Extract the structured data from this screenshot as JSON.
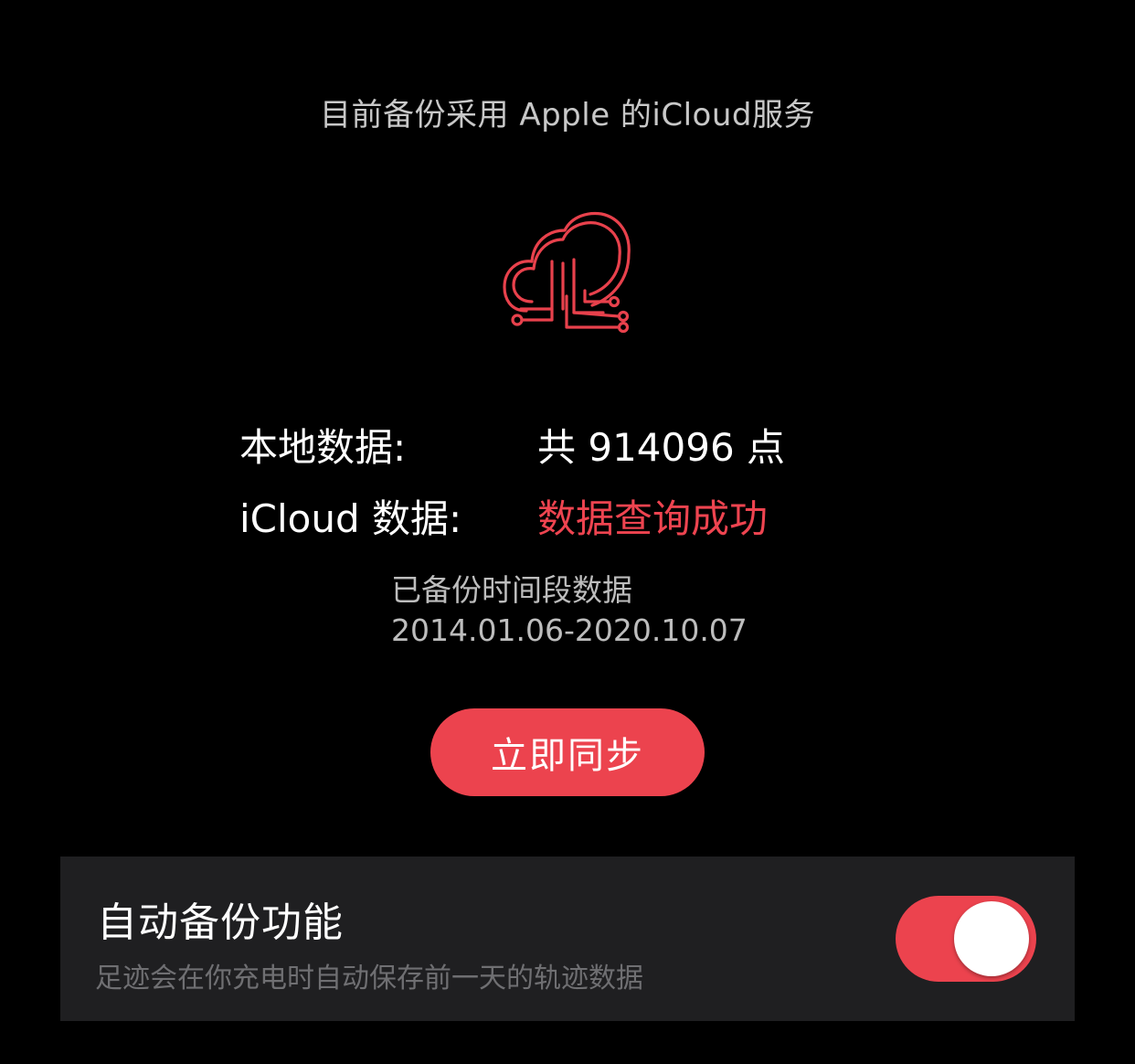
{
  "header": {
    "text": "目前备份采用 Apple 的iCloud服务"
  },
  "icon": {
    "name": "cloud-circuit-icon",
    "color": "#e8414c"
  },
  "local_data": {
    "label": "本地数据:",
    "value": "共 914096 点"
  },
  "icloud_data": {
    "label": "iCloud 数据:",
    "value": "数据查询成功",
    "value_color": "#ee4450"
  },
  "backup_period": {
    "label": "已备份时间段数据",
    "range": "2014.01.06-2020.10.07"
  },
  "sync_button": {
    "label": "立即同步",
    "color": "#ec434e"
  },
  "auto_backup": {
    "title": "自动备份功能",
    "description": "足迹会在你充电时自动保存前一天的轨迹数据",
    "enabled": true,
    "toggle_color": "#ec434e"
  }
}
